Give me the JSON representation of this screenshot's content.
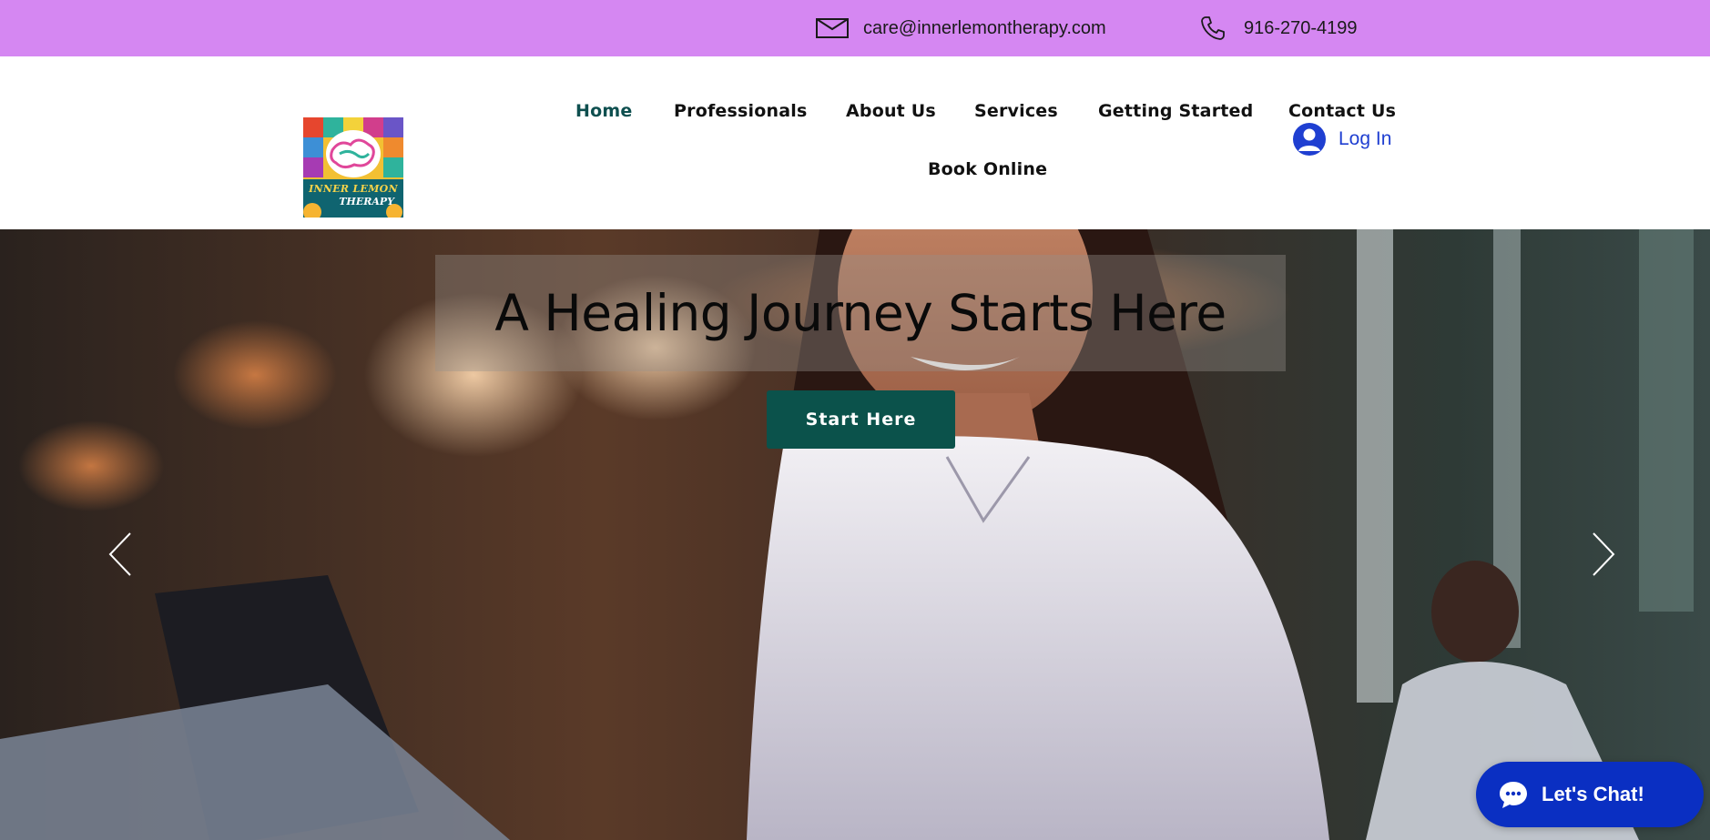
{
  "topbar": {
    "email": "care@innerlemontherapy.com",
    "phone": "916-270-4199",
    "background": "#d587f2"
  },
  "header": {
    "logo": {
      "line1": "INNER LEMON",
      "line2": "THERAPY"
    },
    "nav": [
      {
        "label": "Home",
        "active": true
      },
      {
        "label": "Professionals"
      },
      {
        "label": "About Us"
      },
      {
        "label": "Services"
      },
      {
        "label": "Getting Started"
      },
      {
        "label": "Contact Us"
      },
      {
        "label": "Book Online"
      }
    ],
    "login_label": "Log In",
    "active_color": "#0e4f4f"
  },
  "hero": {
    "headline": "A Healing Journey Starts Here",
    "cta_label": "Start Here",
    "cta_color": "#0b524b",
    "prev_icon": "chevron-left-icon",
    "next_icon": "chevron-right-icon"
  },
  "chat": {
    "label": "Let's Chat!",
    "color": "#0a2fc2",
    "icon": "chat-bubble-icon"
  }
}
